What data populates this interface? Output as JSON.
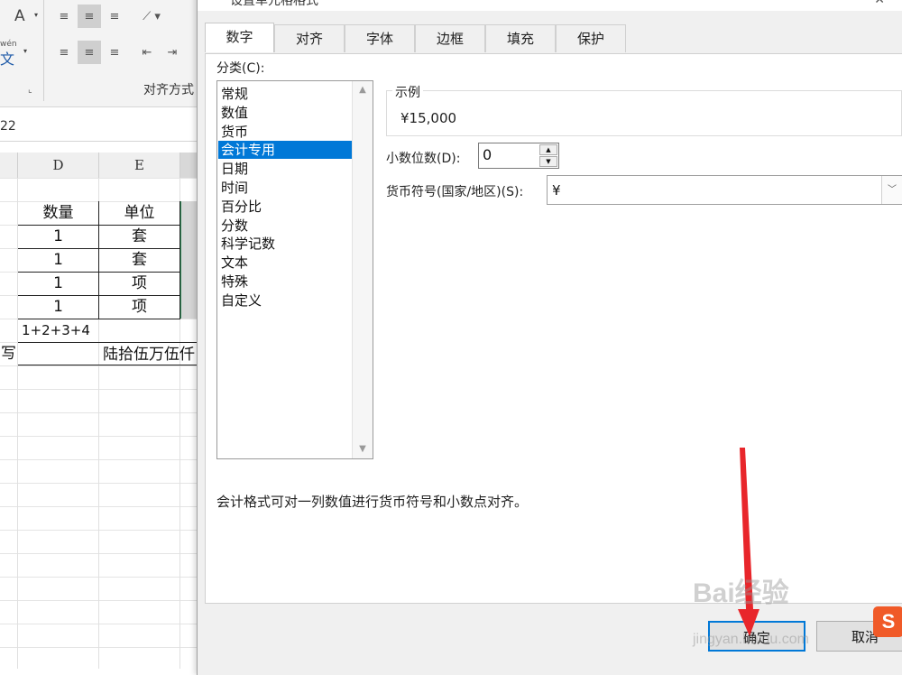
{
  "excel": {
    "ribbon": {
      "font_letter": "A",
      "phonetic_top": "wén",
      "phonetic_char": "文",
      "group_label": "对齐方式",
      "launcher": "⌞"
    },
    "name_box": "22",
    "columns": [
      "D",
      "E"
    ],
    "rows": [
      {
        "d": "数量",
        "e": "单位"
      },
      {
        "d": "1",
        "e": "套"
      },
      {
        "d": "1",
        "e": "套"
      },
      {
        "d": "1",
        "e": "项"
      },
      {
        "d": "1",
        "e": "项"
      }
    ],
    "formula_cell": "1+2+3+4",
    "left_fragment": "写",
    "amount_text": "陆拾伍万伍仟"
  },
  "dialog": {
    "title": "设置单元格格式",
    "tabs": [
      "数字",
      "对齐",
      "字体",
      "边框",
      "填充",
      "保护"
    ],
    "active_tab": "数字",
    "category_label": "分类(C):",
    "categories": [
      "常规",
      "数值",
      "货币",
      "会计专用",
      "日期",
      "时间",
      "百分比",
      "分数",
      "科学记数",
      "文本",
      "特殊",
      "自定义"
    ],
    "selected_category": "会计专用",
    "sample_label": "示例",
    "sample_value": "¥15,000",
    "decimal_label": "小数位数(D):",
    "decimal_value": "0",
    "currency_label": "货币符号(国家/地区)(S):",
    "currency_value": "¥",
    "description": "会计格式可对一列数值进行货币符号和小数点对齐。",
    "ok_label": "确定",
    "cancel_label": "取消"
  },
  "watermark": {
    "brand": "Bai经验",
    "url": "jingyan.baidu.com",
    "logo_letter": "S"
  },
  "colors": {
    "selection": "#0078d7",
    "annotation_arrow": "#e8262b"
  }
}
